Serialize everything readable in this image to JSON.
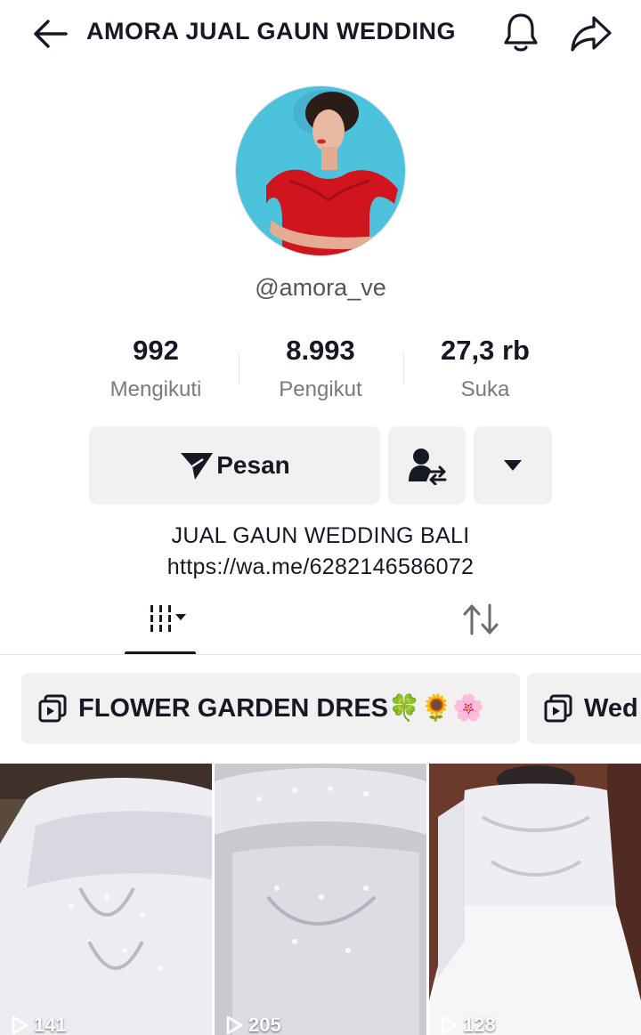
{
  "header": {
    "title": "AMORA JUAL GAUN WEDDING",
    "back_icon": "arrow-left-icon",
    "bell_icon": "bell-icon",
    "share_icon": "share-icon"
  },
  "profile": {
    "username": "@amora_ve",
    "avatar_icon": "profile-photo"
  },
  "stats": [
    {
      "value": "992",
      "label": "Mengikuti"
    },
    {
      "value": "8.993",
      "label": "Pengikut"
    },
    {
      "value": "27,3 rb",
      "label": "Suka"
    }
  ],
  "actions": {
    "message_label": "Pesan",
    "message_icon": "paper-plane-icon",
    "follow_icon": "user-swap-icon",
    "more_icon": "caret-down-icon"
  },
  "bio": {
    "line1": "JUAL GAUN WEDDING BALI",
    "line2": "https://wa.me/6282146586072"
  },
  "tabs": {
    "videos_icon": "grid-icon",
    "reposts_icon": "repost-icon"
  },
  "playlists": [
    {
      "label": "FLOWER GARDEN DRES🍀🌻🌸"
    },
    {
      "label": "Wed"
    }
  ],
  "videos": [
    {
      "views": "141"
    },
    {
      "views": "205"
    },
    {
      "views": "128"
    }
  ],
  "colors": {
    "text": "#161823",
    "muted": "#7a7a7e",
    "button_bg": "#f1f1f2",
    "avatar_bg": "#4dc2dc",
    "dress_red": "#d1151f"
  }
}
